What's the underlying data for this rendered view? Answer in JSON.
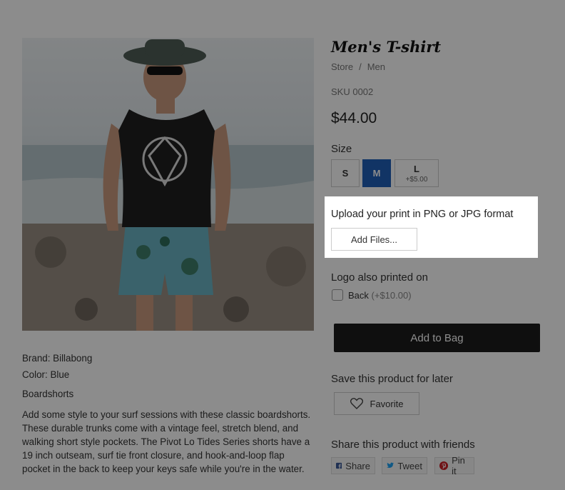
{
  "product": {
    "title": "Men's T-shirt",
    "breadcrumb": {
      "store": "Store",
      "separator": "/",
      "category": "Men"
    },
    "sku": "SKU 0002",
    "price": "$44.00"
  },
  "size": {
    "label": "Size",
    "options": [
      {
        "label": "S",
        "extra": ""
      },
      {
        "label": "M",
        "extra": "",
        "selected": true
      },
      {
        "label": "L",
        "extra": "+$5.00"
      }
    ]
  },
  "upload": {
    "title": "Upload your print in PNG or JPG format",
    "button": "Add Files..."
  },
  "logo_option": {
    "label": "Logo also printed on",
    "checkbox_label": "Back",
    "checkbox_price": "(+$10.00)",
    "checked": false
  },
  "cart": {
    "add_button": "Add to Bag"
  },
  "save": {
    "label": "Save this product for later",
    "favorite_button": "Favorite"
  },
  "share": {
    "label": "Share this product with friends",
    "facebook": "Share",
    "twitter": "Tweet",
    "pinterest": "Pin it"
  },
  "description": {
    "brand": "Brand: Billabong",
    "color": "Color: Blue",
    "category": "Boardshorts",
    "body": "Add some style to your surf sessions with these classic boardshorts. These durable trunks come with a vintage feel, stretch blend, and walking short style pockets. The Pivot Lo Tides Series shorts have a 19 inch outseam, surf tie front closure, and hook-and-loop flap pocket in the back to keep your keys safe while you're in the water."
  },
  "colors": {
    "selected_size": "#1f5fb8",
    "add_to_bag": "#1c1c1c",
    "facebook": "#3b5998",
    "twitter": "#1da1f2",
    "pinterest": "#cb2027",
    "overlay": "rgba(0,0,0,0.45)"
  },
  "icons": {
    "favorite": "heart-icon",
    "facebook": "facebook-icon",
    "twitter": "twitter-icon",
    "pinterest": "pinterest-icon"
  }
}
